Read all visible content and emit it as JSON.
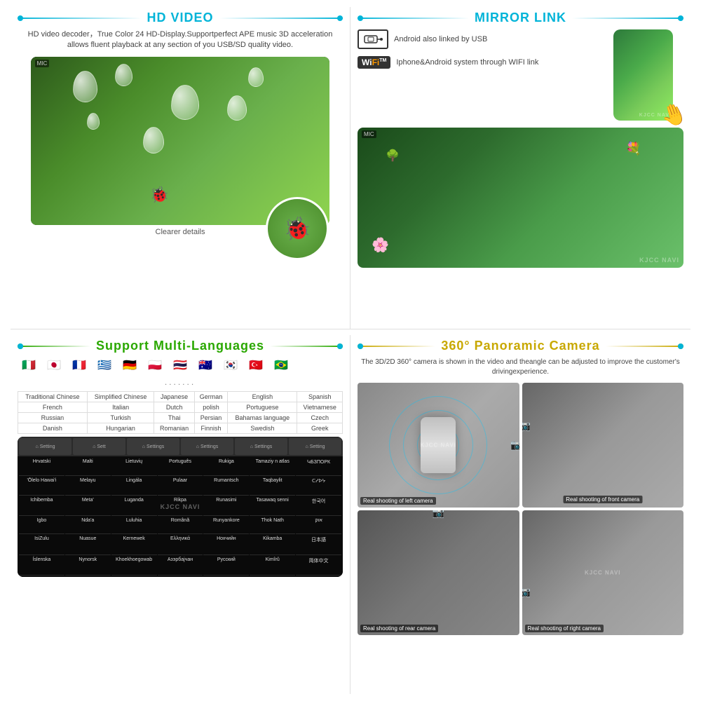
{
  "brand": "KJCC NAVI",
  "top_section": {
    "hd_video": {
      "title": "HD VIDEO",
      "description": "HD video decoder，True Color 24 HD-Display.Supportperfect APE music 3D acceleration allows fluent playback at any section of you USB/SD quality video.",
      "clearer_label": "Clearer details",
      "watermark": "KJCC NAVI"
    },
    "mirror_link": {
      "title": "MIRROR LINK",
      "usb_feature": "Android also linked by USB",
      "wifi_feature": "Iphone&Android system through WIFI link",
      "watermark": "KJCC NAVI"
    }
  },
  "bottom_section": {
    "multi_languages": {
      "title": "Support Multi-Languages",
      "dots": ".......",
      "table": {
        "headers": [
          "Traditional Chinese",
          "Simplified Chinese",
          "Japanese",
          "German",
          "English",
          "Spanish"
        ],
        "rows": [
          [
            "French",
            "Italian",
            "Dutch",
            "polish",
            "Portuguese",
            "Vietnamese"
          ],
          [
            "Russian",
            "Turkish",
            "Thai",
            "Persian",
            "Bahamas language",
            "Czech"
          ],
          [
            "Danish",
            "Hungarian",
            "Romanian",
            "Finnish",
            "Swedish",
            "Greek"
          ]
        ]
      },
      "languages": [
        "Hrvatski",
        "Malti",
        "Lietuvių",
        "Português",
        "Rukiga",
        "Tamaziy t n atlas",
        "ԿБЗПОРК",
        "'Ōlelo Hawai'i",
        "Melayu",
        "Lingála",
        "Pulaar",
        "Rumantsch",
        "Taqbaylit",
        "ᑕᓯᐅᔭ",
        "Ichibemba",
        "Meta'",
        "Luganda",
        "Rikpa",
        "Runasimi",
        "Tasawaq senni",
        "한국어",
        "Igbo",
        "Nda'a",
        "Luluhia",
        "Română",
        "Runyankore",
        "Thok Nath",
        "אוק",
        "IsiZulu",
        "Nuasue",
        "Kernewek",
        "Ελληνικά",
        "Нохчийн",
        "Kikamba",
        "日本語",
        "Íslenska",
        "Nynorsk",
        "Khoekhoegowab",
        "Азэрбajчан (Кирил)",
        "Русский",
        "Kimîrû",
        "简体中文"
      ],
      "flags": [
        "🇮🇹",
        "🇯🇵",
        "🇫🇷",
        "🇬🇷",
        "🇩🇪",
        "🇵🇱",
        "🇹🇭",
        "🇦🇺",
        "🇰🇷",
        "🇹🇷",
        "🇧🇷"
      ]
    },
    "panoramic": {
      "title": "360° Panoramic Camera",
      "description": "The 3D/2D 360° camera is shown in the video and theangle can be adjusted to improve the customer's drivingexperience.",
      "cameras": [
        {
          "label": "Real shooting of left camera",
          "position": "top-left"
        },
        {
          "label": "Real shooting of front camera",
          "position": "top-right"
        },
        {
          "label": "Real shooting of rear camera",
          "position": "bottom-left"
        },
        {
          "label": "Real shooting of right camera",
          "position": "bottom-right"
        }
      ],
      "watermark": "KJCC NAVI"
    }
  }
}
